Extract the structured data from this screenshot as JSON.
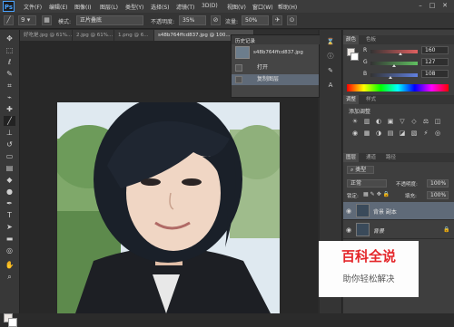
{
  "app": {
    "logo": "Ps"
  },
  "menu": [
    "文件(F)",
    "编辑(E)",
    "图像(I)",
    "图层(L)",
    "类型(Y)",
    "选择(S)",
    "滤镜(T)",
    "3D(D)",
    "视图(V)",
    "窗口(W)",
    "帮助(H)"
  ],
  "window_controls": {
    "minimize": "–",
    "maximize": "□",
    "close": "✕"
  },
  "options": {
    "brush_size": "9",
    "mode_label": "模式:",
    "mode_value": "正片叠底",
    "opacity_label": "不透明度:",
    "opacity_value": "35%",
    "flow_label": "流量:",
    "flow_value": "50%"
  },
  "tabs": [
    {
      "label": "好吃是.jpg @ 61%..."
    },
    {
      "label": "2.jpg @ 61%..."
    },
    {
      "label": "1.png @ 6..."
    },
    {
      "label": "s48b764ffcd837.jpg @ 100..."
    }
  ],
  "history": {
    "title": "历史记录",
    "snapshot": "s48b764ffcd837.jpg",
    "items": [
      {
        "label": "打开"
      },
      {
        "label": "复制图层"
      }
    ]
  },
  "color_panel": {
    "tabs": [
      "颜色",
      "色板"
    ],
    "sliders": [
      {
        "label": "R",
        "value": "160",
        "fraction": 0.63,
        "color": "#e06060"
      },
      {
        "label": "G",
        "value": "127",
        "fraction": 0.5,
        "color": "#60c060"
      },
      {
        "label": "B",
        "value": "108",
        "fraction": 0.42,
        "color": "#6080e0"
      }
    ]
  },
  "adjust_panel": {
    "tabs": [
      "调整",
      "样式"
    ],
    "title": "添加调整",
    "icons": [
      "☀",
      "▥",
      "◐",
      "▣",
      "▽",
      "◇",
      "⚖",
      "◫",
      "◉",
      "▦",
      "◑",
      "▤",
      "◪",
      "▧",
      "⚡",
      "◎"
    ]
  },
  "layers_panel": {
    "tabs": [
      "图层",
      "通道",
      "路径"
    ],
    "kind_label": "类型",
    "blend_mode": "正常",
    "opacity_label": "不透明度:",
    "opacity_value": "100%",
    "lock_label": "锁定:",
    "fill_label": "填充:",
    "fill_value": "100%",
    "layers": [
      {
        "name": "背景 副本"
      },
      {
        "name": "背景"
      }
    ]
  },
  "watermark": {
    "title": "百科全说",
    "subtitle": "助你轻松解决"
  },
  "colors": {
    "fg": "#ece7e3",
    "bg": "#ffffff",
    "accent": "#4aa3ff",
    "watermark_red": "#e4262a"
  }
}
